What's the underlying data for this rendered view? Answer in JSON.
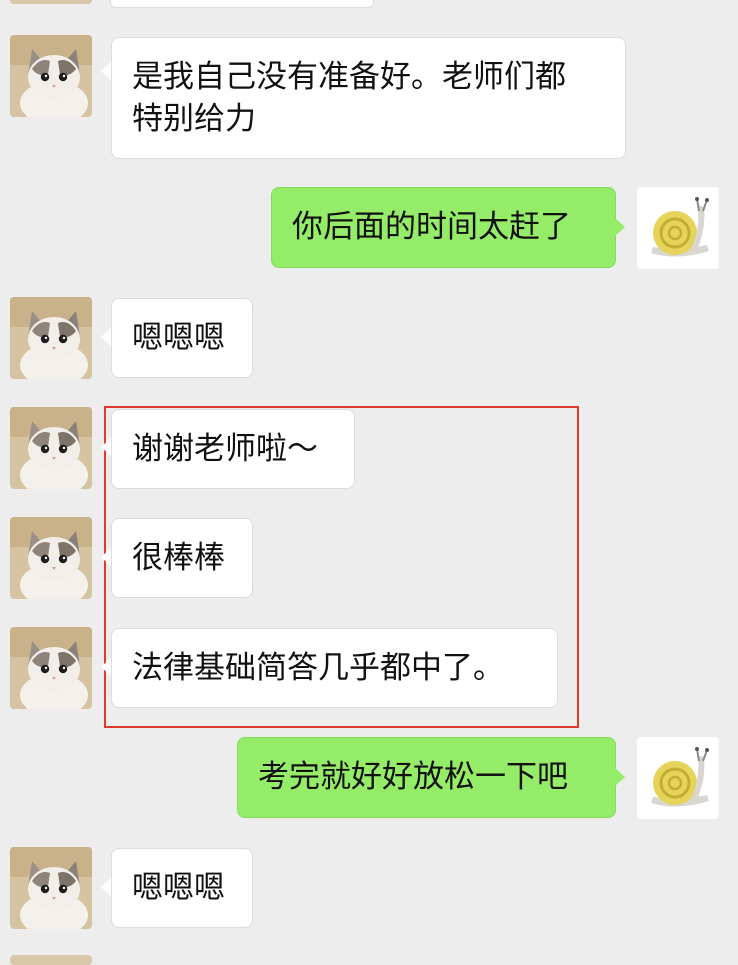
{
  "colors": {
    "incoming_bubble": "#ffffff",
    "outgoing_bubble": "#95ec69",
    "highlight_border": "#e03a2e"
  },
  "icons": {
    "incoming_avatar": "cat-avatar-icon",
    "outgoing_avatar": "snail-avatar-icon"
  },
  "messages": [
    {
      "direction": "incoming",
      "text_lines": [
        "是我自己没有准备好。老师们都",
        "特别给力"
      ]
    },
    {
      "direction": "outgoing",
      "text_lines": [
        "你后面的时间太赶了"
      ]
    },
    {
      "direction": "incoming",
      "text_lines": [
        "嗯嗯嗯"
      ]
    },
    {
      "direction": "incoming",
      "text_lines": [
        "谢谢老师啦～"
      ]
    },
    {
      "direction": "incoming",
      "text_lines": [
        "很棒棒"
      ]
    },
    {
      "direction": "incoming",
      "text_lines": [
        "法律基础简答几乎都中了。"
      ]
    },
    {
      "direction": "outgoing",
      "text_lines": [
        "考完就好好放松一下吧"
      ]
    },
    {
      "direction": "incoming",
      "text_lines": [
        "嗯嗯嗯"
      ]
    }
  ]
}
